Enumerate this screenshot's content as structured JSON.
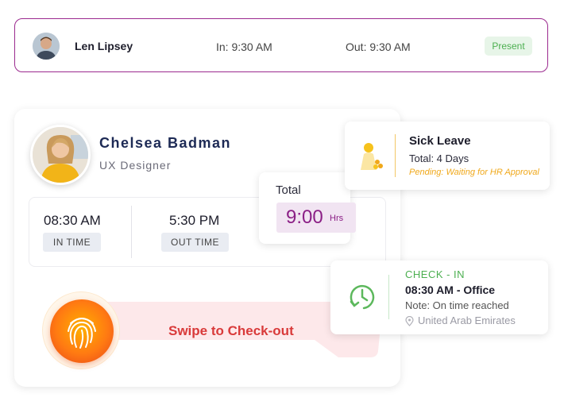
{
  "attendance_row": {
    "name": "Len Lipsey",
    "in_time": "In: 9:30 AM",
    "out_time": "Out: 9:30 AM",
    "status": "Present"
  },
  "profile": {
    "name": "Chelsea Badman",
    "role": "UX Designer",
    "in_time_value": "08:30 AM",
    "in_time_label": "IN TIME",
    "out_time_value": "5:30 PM",
    "out_time_label": "OUT TIME",
    "total_label": "Total",
    "total_value": "9:00",
    "total_unit": "Hrs",
    "swipe_label": "Swipe to Check-out"
  },
  "leave": {
    "title": "Sick Leave",
    "total": "Total: 4 Days",
    "status": "Pending: Waiting for HR Approval"
  },
  "check_in": {
    "title": "CHECK - IN",
    "time": "08:30 AM - Office",
    "note": "Note: On time reached",
    "location": "United Arab Emirates"
  },
  "colors": {
    "accent_purple": "#8b1f86",
    "present_green": "#4caf50",
    "swipe_red": "#d93a3a",
    "leave_amber": "#f0a81a"
  },
  "icons": {
    "row_avatar": "avatar-photo",
    "profile_avatar": "avatar-photo",
    "fingerprint": "fingerprint-icon",
    "leave": "sick-leave-icon",
    "check_in": "clock-refresh-icon",
    "location": "location-pin-icon"
  }
}
